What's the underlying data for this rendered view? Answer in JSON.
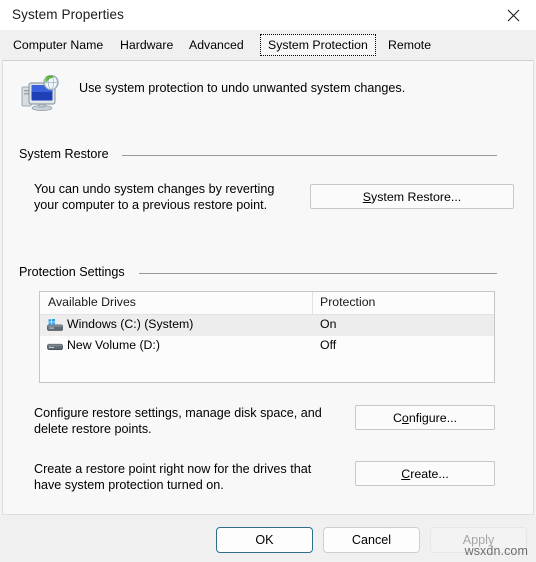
{
  "window": {
    "title": "System Properties",
    "close_icon": "close-icon"
  },
  "tabs": [
    {
      "label": "Computer Name",
      "selected": false
    },
    {
      "label": "Hardware",
      "selected": false
    },
    {
      "label": "Advanced",
      "selected": false
    },
    {
      "label": "System Protection",
      "selected": true
    },
    {
      "label": "Remote",
      "selected": false
    }
  ],
  "intro": {
    "icon": "system-protection-icon",
    "text": "Use system protection to undo unwanted system changes."
  },
  "system_restore": {
    "group_label": "System Restore",
    "description_line1": "You can undo system changes by reverting",
    "description_line2": "your computer to a previous restore point.",
    "button": {
      "accel": "S",
      "rest": "ystem Restore..."
    }
  },
  "protection_settings": {
    "group_label": "Protection Settings",
    "table": {
      "columns": [
        "Available Drives",
        "Protection"
      ],
      "rows": [
        {
          "icon": "windows-drive-icon",
          "name": "Windows (C:) (System)",
          "protection": "On",
          "selected": true
        },
        {
          "icon": "drive-icon",
          "name": "New Volume (D:)",
          "protection": "Off",
          "selected": false
        }
      ]
    },
    "configure": {
      "description_line1": "Configure restore settings, manage disk space, and",
      "description_line2": "delete restore points.",
      "button": {
        "pre": "C",
        "accel": "o",
        "rest": "nfigure..."
      }
    },
    "create": {
      "description_line1": "Create a restore point right now for the drives that",
      "description_line2": "have system protection turned on.",
      "button": {
        "accel": "C",
        "rest": "reate..."
      }
    }
  },
  "footer": {
    "ok": "OK",
    "cancel": "Cancel",
    "apply": "Apply"
  },
  "watermark": "wsxdn.com",
  "colors": {
    "window_bg": "#f0f0f0",
    "panel_bg": "#f8f8f8",
    "titlebar_bg": "#ffffff",
    "default_button_border": "#2e6f8e",
    "selected_row_bg": "#ededed",
    "disabled_text": "#a5a5a5"
  }
}
